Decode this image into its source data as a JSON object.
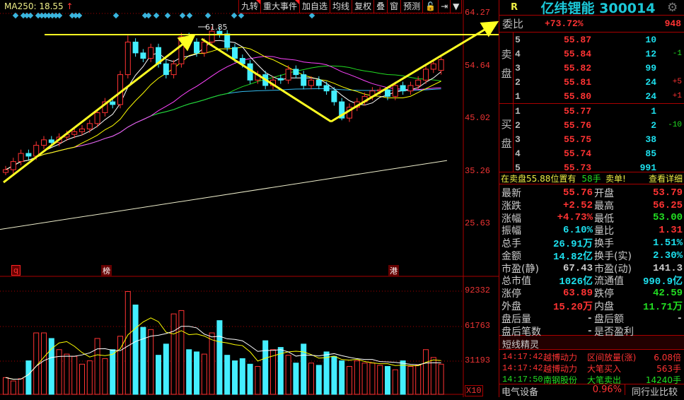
{
  "toolbar": {
    "ma250_label": "MA250: 18.55",
    "ma250_arrow": "↑",
    "buttons": [
      "九转",
      "重大事件",
      "加自选",
      "均线",
      "复权",
      "叠",
      "窗",
      "预测",
      "🔓",
      "⇥",
      "▼"
    ]
  },
  "axis": {
    "price_ticks": [
      "64.27",
      "54.64",
      "45.02",
      "35.26",
      "25.63"
    ],
    "volume_ticks": [
      "92332",
      "61763",
      "31193"
    ],
    "volume_unit": "X10",
    "peak_label": "61.85"
  },
  "markers": [
    "q",
    "榜",
    "港"
  ],
  "chart_data": {
    "type": "candlestick",
    "price_range": [
      25.63,
      64.27
    ],
    "volume_range": [
      0,
      92332
    ],
    "candles": [
      [
        35,
        36.2,
        34.5,
        35.5
      ],
      [
        35.5,
        37.7,
        34.8,
        37
      ],
      [
        37,
        39.2,
        36.3,
        38.5
      ],
      [
        38.5,
        39.2,
        37.3,
        38
      ],
      [
        38,
        40.7,
        37.3,
        40
      ],
      [
        40,
        41.7,
        39.3,
        41
      ],
      [
        41,
        41.7,
        39.8,
        40.5
      ],
      [
        40.5,
        42.2,
        39.8,
        41.5
      ],
      [
        41.5,
        42.7,
        40.8,
        42
      ],
      [
        42,
        43.2,
        41.3,
        42.5
      ],
      [
        42.5,
        43.7,
        41.8,
        43
      ],
      [
        43,
        44.7,
        42.3,
        44
      ],
      [
        44,
        46.7,
        43.3,
        46
      ],
      [
        46,
        48.7,
        45.3,
        48
      ],
      [
        48,
        48.7,
        46.8,
        47.5
      ],
      [
        47.5,
        53.7,
        46.8,
        53
      ],
      [
        53,
        60.2,
        52.3,
        59
      ],
      [
        59,
        59.7,
        56.3,
        57
      ],
      [
        57,
        57.7,
        55.3,
        56
      ],
      [
        56,
        58.7,
        55.3,
        58
      ],
      [
        58,
        58.7,
        54.3,
        55
      ],
      [
        55,
        55.7,
        52.3,
        53
      ],
      [
        53,
        55.7,
        52.3,
        55
      ],
      [
        55,
        60.7,
        54.3,
        60
      ],
      [
        60,
        60.7,
        58.3,
        59
      ],
      [
        59,
        59.7,
        56.3,
        57
      ],
      [
        57,
        59.7,
        56.3,
        59
      ],
      [
        59,
        61.85,
        58.3,
        61
      ],
      [
        61,
        61.7,
        59.8,
        60.5
      ],
      [
        60.5,
        61.2,
        57.3,
        58
      ],
      [
        58,
        58.7,
        55.3,
        56
      ],
      [
        56,
        56.7,
        54.3,
        55
      ],
      [
        55,
        55.7,
        51.3,
        52
      ],
      [
        52,
        53.7,
        51.3,
        53
      ],
      [
        53,
        53.7,
        50.3,
        51
      ],
      [
        51,
        52.7,
        50.3,
        52
      ],
      [
        52.3,
        53,
        51.3,
        52
      ],
      [
        52,
        54.7,
        51.3,
        54
      ],
      [
        54,
        54.7,
        52.3,
        53
      ],
      [
        53,
        53.7,
        50.3,
        51
      ],
      [
        51,
        52.7,
        50.3,
        52
      ],
      [
        52,
        52.7,
        50.3,
        51
      ],
      [
        51,
        51.7,
        49.3,
        50
      ],
      [
        50,
        50.7,
        47.3,
        48
      ],
      [
        48,
        48.7,
        44.6,
        45
      ],
      [
        45,
        47.7,
        44.3,
        47
      ],
      [
        47,
        48.7,
        46.3,
        48
      ],
      [
        48,
        49.7,
        47.3,
        49
      ],
      [
        49,
        50.7,
        48.3,
        50
      ],
      [
        50,
        50.7,
        49.3,
        50.2
      ],
      [
        50.2,
        50.7,
        48.3,
        49
      ],
      [
        49,
        51.7,
        48.3,
        51
      ],
      [
        51,
        51.7,
        49.3,
        50
      ],
      [
        50,
        51.7,
        49.3,
        51
      ],
      [
        51,
        52.7,
        50.3,
        52
      ],
      [
        52,
        54.7,
        51.3,
        54
      ],
      [
        54,
        55.7,
        53.3,
        55
      ],
      [
        53.79,
        56.25,
        53,
        55.76
      ]
    ],
    "volumes": [
      15000,
      12000,
      14000,
      30000,
      55000,
      55000,
      50000,
      40000,
      36000,
      34000,
      27000,
      30000,
      50000,
      32000,
      40000,
      52000,
      92000,
      80000,
      60000,
      58000,
      35000,
      45000,
      72000,
      75000,
      40000,
      38000,
      36000,
      55000,
      66000,
      35000,
      30000,
      32000,
      27000,
      25000,
      48000,
      40000,
      42000,
      35000,
      28000,
      45000,
      28000,
      26000,
      38000,
      34000,
      30000,
      25000,
      30000,
      28000,
      28000,
      26000,
      25000,
      22000,
      30000,
      25000,
      26000,
      40000,
      33000,
      27000
    ],
    "long_ma": [
      24.5,
      37.2
    ],
    "colors": {
      "up": "#ff3333",
      "down": "#44eeff",
      "ma5": "#ffffff",
      "ma10": "#ffff00",
      "ma20": "#ff44ff",
      "ma30": "#22dd22",
      "ma60": "#33bbee"
    }
  },
  "panel": {
    "r_label": "R",
    "stock_name": "亿纬锂能 300014",
    "weibi_label": "委比",
    "weibi_pct": "+73.72%",
    "weibi_diff": "948",
    "sell_label": "卖盘",
    "buy_label": "买盘",
    "sell": [
      {
        "lv": "5",
        "p": "55.87",
        "v": "10",
        "c": ""
      },
      {
        "lv": "4",
        "p": "55.84",
        "v": "12",
        "c": "-1"
      },
      {
        "lv": "3",
        "p": "55.82",
        "v": "99",
        "c": ""
      },
      {
        "lv": "2",
        "p": "55.81",
        "v": "24",
        "c": "+5"
      },
      {
        "lv": "1",
        "p": "55.80",
        "v": "24",
        "c": "+1"
      }
    ],
    "buy": [
      {
        "lv": "1",
        "p": "55.77",
        "v": "1",
        "c": ""
      },
      {
        "lv": "2",
        "p": "55.76",
        "v": "2",
        "c": "-10"
      },
      {
        "lv": "3",
        "p": "55.75",
        "v": "38",
        "c": ""
      },
      {
        "lv": "4",
        "p": "55.74",
        "v": "85",
        "c": ""
      },
      {
        "lv": "5",
        "p": "55.73",
        "v": "991",
        "c": ""
      }
    ],
    "notice": {
      "text": "在卖盘55.88位置有",
      "qty": "58手",
      "type": "卖单!",
      "link": "查看详细"
    },
    "stats": [
      {
        "k": "最新",
        "v": "55.76",
        "vc": "red",
        "k2": "开盘",
        "v2": "53.79",
        "v2c": "red"
      },
      {
        "k": "涨跌",
        "v": "+2.52",
        "vc": "red",
        "k2": "最高",
        "v2": "56.25",
        "v2c": "red"
      },
      {
        "k": "涨幅",
        "v": "+4.73%",
        "vc": "red",
        "k2": "最低",
        "v2": "53.00",
        "v2c": "green"
      },
      {
        "k": "振幅",
        "v": "6.10%",
        "vc": "cyan",
        "k2": "量比",
        "v2": "1.31",
        "v2c": "red"
      },
      {
        "k": "总手",
        "v": "26.91万",
        "vc": "cyan",
        "k2": "换手",
        "v2": "1.51%",
        "v2c": "cyan"
      },
      {
        "k": "金额",
        "v": "14.82亿",
        "vc": "cyan",
        "k2": "换手(实)",
        "v2": "2.30%",
        "v2c": "cyan"
      },
      {
        "k": "市盈(静)",
        "v": "67.43",
        "vc": "gray",
        "k2": "市盈(动)",
        "v2": "141.3",
        "v2c": "gray"
      },
      {
        "k": "总市值",
        "v": "1026亿",
        "vc": "cyan",
        "k2": "流通值",
        "v2": "990.9亿",
        "v2c": "cyan"
      },
      {
        "k": "涨停",
        "v": "63.89",
        "vc": "red",
        "k2": "跌停",
        "v2": "42.59",
        "v2c": "green"
      },
      {
        "k": "外盘",
        "v": "15.20万",
        "vc": "red",
        "k2": "内盘",
        "v2": "11.71万",
        "v2c": "green"
      },
      {
        "k": "盘后量",
        "v": "-",
        "vc": "gray",
        "k2": "盘后额",
        "v2": "-",
        "v2c": "gray"
      },
      {
        "k": "盘后笔数",
        "v": "-",
        "vc": "gray",
        "k2": "是否盈利",
        "v2": "",
        "v2c": "gray"
      }
    ],
    "elf_title": "短线精灵",
    "elf": [
      {
        "t": "14:17:42",
        "s": "越博动力",
        "e": "区间放量(涨)",
        "n": "6.08倍",
        "c": "red"
      },
      {
        "t": "14:17:42",
        "s": "越博动力",
        "e": "大笔买入",
        "n": "563手",
        "c": "red"
      },
      {
        "t": "14:17:50",
        "s": "南钢股份",
        "e": "大笔卖出",
        "n": "14240手",
        "c": "green"
      }
    ],
    "sector": {
      "name": "电气设备",
      "pct": "0.96%",
      "compare": "同行业比较"
    }
  }
}
